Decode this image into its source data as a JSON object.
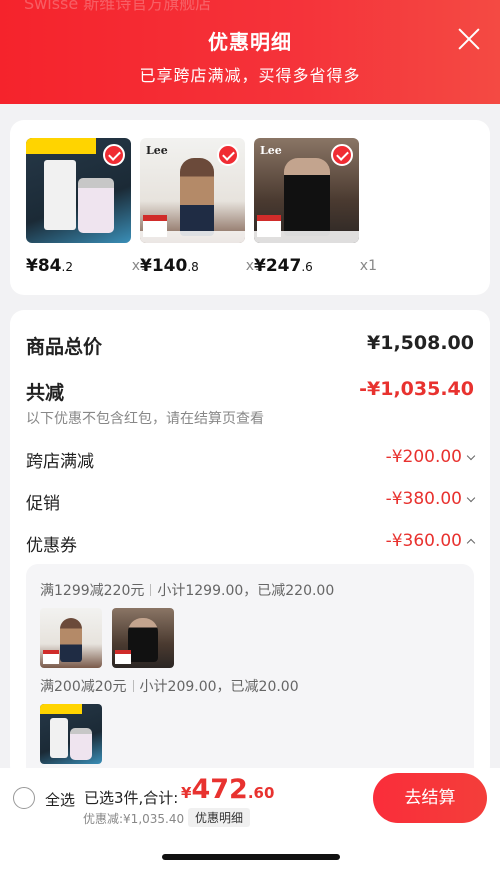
{
  "header": {
    "background_text": "Swisse 斯维诗官方旗舰店",
    "title": "优惠明细",
    "subtitle": "已享跨店满减，买得多省得多"
  },
  "products": [
    {
      "name": "Swisse",
      "price_int": "¥84",
      "price_dec": ".2",
      "qty": "x1",
      "selected": true
    },
    {
      "name": "Lee",
      "price_int": "¥140",
      "price_dec": ".8",
      "qty": "x1",
      "selected": true
    },
    {
      "name": "Lee",
      "price_int": "¥247",
      "price_dec": ".6",
      "qty": "x1",
      "selected": true
    }
  ],
  "summary": {
    "total_label": "商品总价",
    "total_value": "¥1,508.00",
    "discount_label": "共减",
    "discount_value": "-¥1,035.40",
    "discount_note": "以下优惠不包含红包，请在结算页查看",
    "lines": [
      {
        "label": "跨店满减",
        "value": "-¥200.00"
      },
      {
        "label": "促销",
        "value": "-¥380.00"
      },
      {
        "label": "优惠券",
        "value": "-¥360.00"
      }
    ]
  },
  "coupon_groups": [
    {
      "rule": "满1299减220元",
      "detail": "小计1299.00，已减220.00"
    },
    {
      "rule": "满200减20元",
      "detail": "小计209.00，已减20.00"
    }
  ],
  "bottom": {
    "select_all": "全选",
    "selected_info": "已选3件,合计:",
    "total_yen": "¥",
    "total_int": "472",
    "total_dec": ".60",
    "discount_text": "优惠减:¥1,035.40",
    "detail_button": "优惠明细",
    "checkout_button": "去结算"
  },
  "colors": {
    "accent": "#e8322f",
    "header": "#f5232c"
  }
}
